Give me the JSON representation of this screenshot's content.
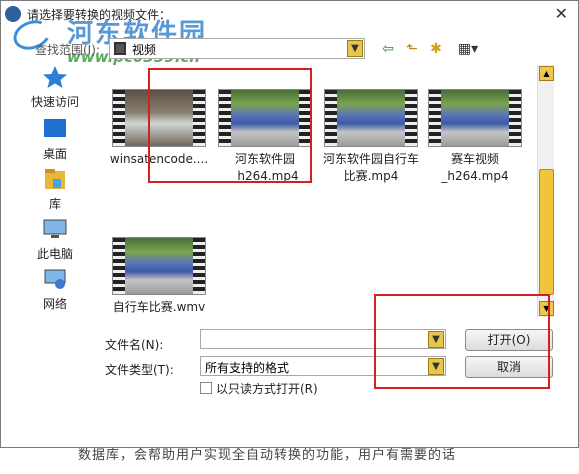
{
  "titlebar": {
    "title": "请选择要转换的视频文件：",
    "close": "✕"
  },
  "watermark": {
    "line1": "河东软件园",
    "line2": "www.pc0359.cn"
  },
  "lookin": {
    "label": "查找范围(I):",
    "value": "视频"
  },
  "toolbar": {
    "back": "⇦",
    "up": "⬑",
    "new_folder": "✱",
    "view": "▦▾"
  },
  "sidebar": {
    "items": [
      {
        "label": "快速访问",
        "icon": "star-icon"
      },
      {
        "label": "桌面",
        "icon": "desktop-icon"
      },
      {
        "label": "库",
        "icon": "library-icon"
      },
      {
        "label": "此电脑",
        "icon": "computer-icon"
      },
      {
        "label": "网络",
        "icon": "network-icon"
      }
    ]
  },
  "files": [
    {
      "line1": "winsatencode....",
      "line2": "",
      "scene": "water"
    },
    {
      "line1": "河东软件园",
      "line2": "_h264.mp4",
      "scene": "bikes"
    },
    {
      "line1": "河东软件园自行车",
      "line2": "比赛.mp4",
      "scene": "bikes"
    },
    {
      "line1": "赛车视频",
      "line2": "_h264.mp4",
      "scene": "bikes"
    },
    {
      "line1": "自行车比赛.wmv",
      "line2": "",
      "scene": "bikes"
    }
  ],
  "filename": {
    "label": "文件名(N):",
    "value": ""
  },
  "filetype": {
    "label": "文件类型(T):",
    "value": "所有支持的格式"
  },
  "readonly": {
    "label": "以只读方式打开(R)"
  },
  "buttons": {
    "open": "打开(O)",
    "cancel": "取消"
  },
  "background_text": "数据库，会帮助用户实现全自动转换的功能，用户有需要的话"
}
